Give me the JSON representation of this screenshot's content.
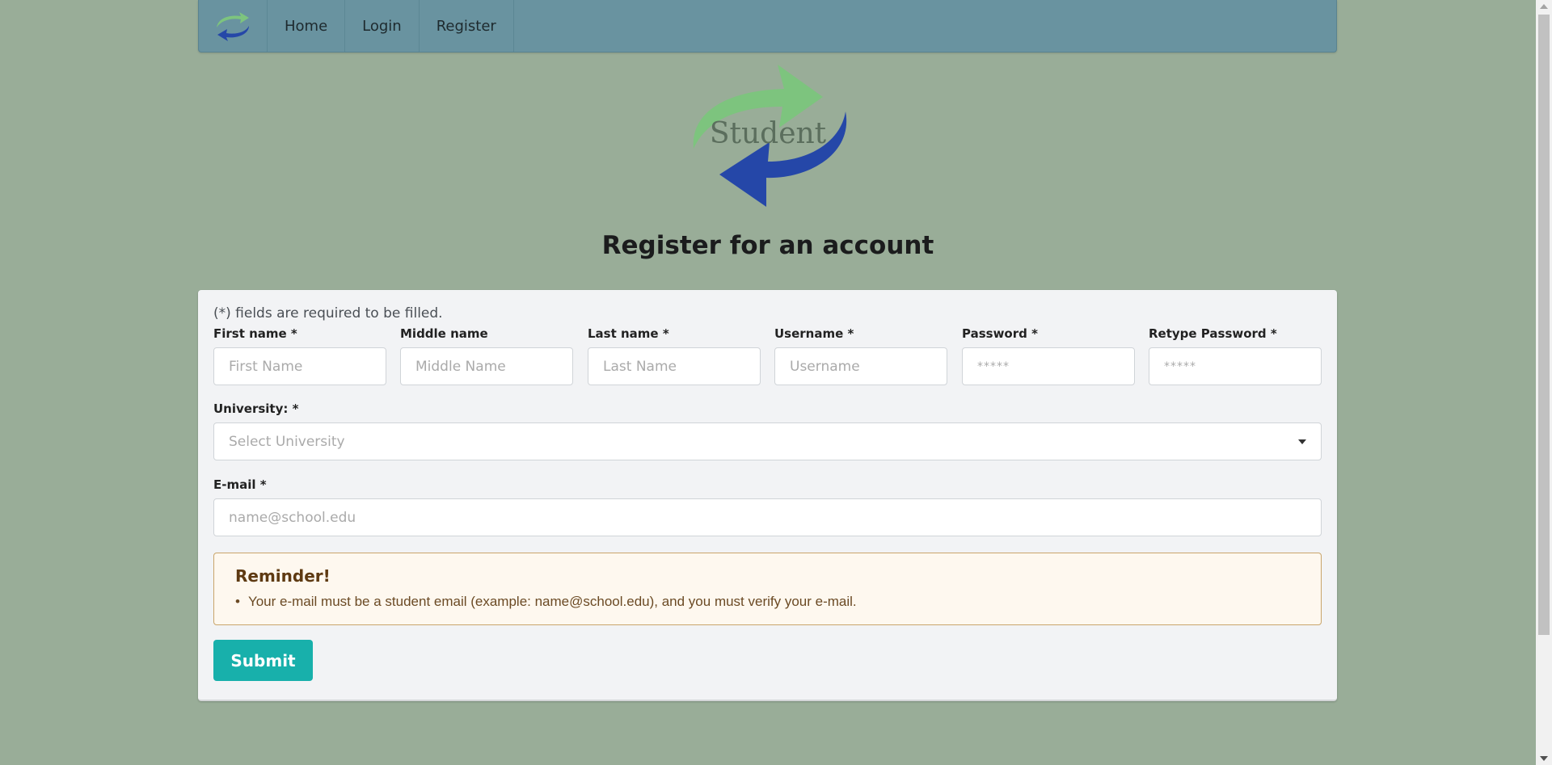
{
  "nav": {
    "items": [
      {
        "label": "Home"
      },
      {
        "label": "Login"
      },
      {
        "label": "Register"
      }
    ]
  },
  "logo": {
    "text": "Student"
  },
  "page_title": "Register for an account",
  "form": {
    "required_note": "(*) fields are required to be filled.",
    "first_name": {
      "label": "First name *",
      "placeholder": "First Name"
    },
    "middle_name": {
      "label": "Middle name",
      "placeholder": "Middle Name"
    },
    "last_name": {
      "label": "Last name *",
      "placeholder": "Last Name"
    },
    "username": {
      "label": "Username *",
      "placeholder": "Username"
    },
    "password": {
      "label": "Password *",
      "placeholder": "*****"
    },
    "retype_password": {
      "label": "Retype Password *",
      "placeholder": "*****"
    },
    "university": {
      "label": "University: *",
      "placeholder": "Select University"
    },
    "email": {
      "label": "E-mail *",
      "placeholder": "name@school.edu"
    },
    "reminder": {
      "title": "Reminder!",
      "text": "Your e-mail must be a student email (example: name@school.edu), and you must verify your e-mail."
    },
    "submit_label": "Submit"
  },
  "colors": {
    "background": "#99ad98",
    "navbar": "#6993a0",
    "submit": "#18b0ab",
    "logo_green": "#7dc47e",
    "logo_blue": "#2547a8"
  }
}
